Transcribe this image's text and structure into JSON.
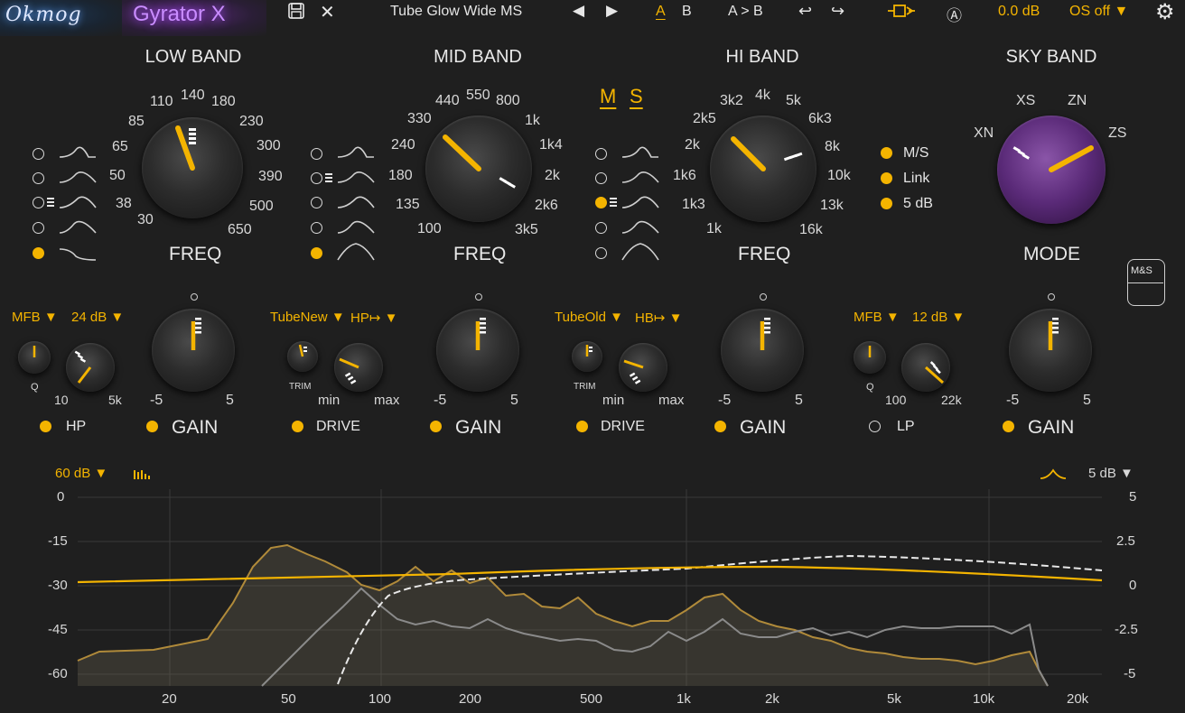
{
  "topbar": {
    "brand": "Okmog",
    "plugin": "Gyrator X",
    "preset": "Tube Glow Wide MS",
    "ab_a": "A",
    "ab_b": "B",
    "copy": "A > B",
    "output_gain": "0.0 dB",
    "oversampling": "OS off",
    "auto_gain": "Ⓐ"
  },
  "bands": {
    "low": {
      "title": "LOW BAND",
      "freq_label": "FREQ",
      "freq_scale": [
        "30",
        "38",
        "50",
        "65",
        "85",
        "110",
        "140",
        "180",
        "230",
        "300",
        "390",
        "500",
        "650"
      ],
      "shape_selected": 4,
      "filter_type": "MFB",
      "filter_slope": "24 dB",
      "filter_knob_min": "10",
      "filter_knob_max": "5k",
      "q_label": "Q",
      "filter_toggle": "HP",
      "gain_label": "GAIN",
      "gain_min": "-5",
      "gain_max": "5"
    },
    "mid": {
      "title": "MID BAND",
      "freq_label": "FREQ",
      "freq_scale": [
        "100",
        "135",
        "180",
        "240",
        "330",
        "440",
        "550",
        "800",
        "1k",
        "1k4",
        "2k",
        "2k6",
        "3k5"
      ],
      "shape_selected": 4,
      "tube_type": "TubeNew",
      "drive_mode": "HP↦",
      "trim_label": "TRIM",
      "drive_min": "min",
      "drive_max": "max",
      "drive_toggle": "DRIVE",
      "gain_label": "GAIN",
      "gain_min": "-5",
      "gain_max": "5"
    },
    "hi": {
      "title": "HI BAND",
      "freq_label": "FREQ",
      "freq_scale": [
        "1k",
        "1k3",
        "1k6",
        "2k",
        "2k5",
        "3k2",
        "4k",
        "5k",
        "6k3",
        "8k",
        "10k",
        "13k",
        "16k"
      ],
      "shape_selected": 2,
      "ms_m": "M",
      "ms_s": "S",
      "tube_type": "TubeOld",
      "drive_mode": "HB↦",
      "trim_label": "TRIM",
      "drive_min": "min",
      "drive_max": "max",
      "drive_toggle": "DRIVE",
      "gain_label": "GAIN",
      "gain_min": "-5",
      "gain_max": "5",
      "options": [
        "M/S",
        "Link",
        "5 dB"
      ]
    },
    "sky": {
      "title": "SKY BAND",
      "mode_label": "MODE",
      "mode_scale": [
        "XN",
        "XS",
        "ZN",
        "ZS"
      ],
      "filter_type": "MFB",
      "filter_slope": "12 dB",
      "filter_knob_min": "100",
      "filter_knob_max": "22k",
      "q_label": "Q",
      "filter_toggle": "LP",
      "gain_label": "GAIN",
      "gain_min": "-5",
      "gain_max": "5",
      "ms_button": "M&S"
    }
  },
  "graph": {
    "range_left": "60 dB",
    "range_right": "5 dB",
    "left_axis": [
      "0",
      "-15",
      "-30",
      "-45",
      "-60"
    ],
    "right_axis": [
      "5",
      "2.5",
      "0",
      "-2.5",
      "-5"
    ],
    "freq_axis": [
      "20",
      "50",
      "100",
      "200",
      "500",
      "1k",
      "2k",
      "5k",
      "10k",
      "20k"
    ]
  },
  "colors": {
    "accent": "#f4b400",
    "purple": "#c98cff",
    "background": "#1f1f1f"
  }
}
